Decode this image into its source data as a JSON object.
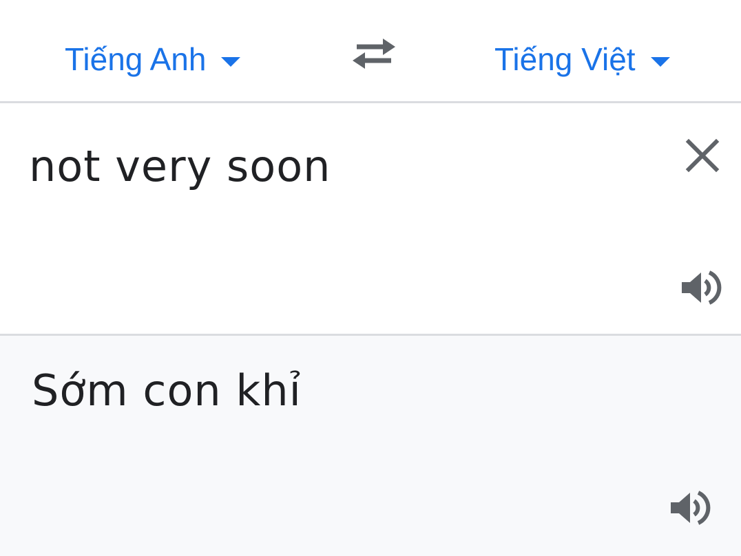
{
  "language_bar": {
    "source_language": "Tiếng Anh",
    "target_language": "Tiếng Việt",
    "swap_icon": "swap-arrows-icon",
    "dropdown_icon": "caret-down-icon"
  },
  "source": {
    "text": "not very soon",
    "clear_icon": "close-icon",
    "speak_icon": "speaker-icon"
  },
  "translation": {
    "text": "Sớm con khỉ",
    "speak_icon": "speaker-icon"
  },
  "colors": {
    "accent": "#1a73e8",
    "text": "#202124",
    "icon": "#5f6368",
    "divider": "#dadce0",
    "translation_background": "#f8f9fb"
  }
}
